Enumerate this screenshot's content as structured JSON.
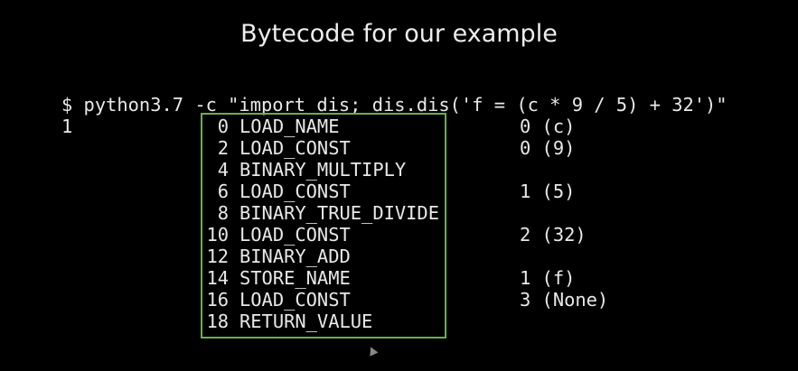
{
  "slide": {
    "title": "Bytecode for our example",
    "command": "$ python3.7 -c \"import dis; dis.dis('f = (c * 9 / 5) + 32')\"",
    "line_number": "1",
    "highlight_color": "#6cae48",
    "instructions": [
      {
        "offset": "0",
        "opname": "LOAD_NAME",
        "arg": "0 (c)"
      },
      {
        "offset": "2",
        "opname": "LOAD_CONST",
        "arg": "0 (9)"
      },
      {
        "offset": "4",
        "opname": "BINARY_MULTIPLY",
        "arg": ""
      },
      {
        "offset": "6",
        "opname": "LOAD_CONST",
        "arg": "1 (5)"
      },
      {
        "offset": "8",
        "opname": "BINARY_TRUE_DIVIDE",
        "arg": ""
      },
      {
        "offset": "10",
        "opname": "LOAD_CONST",
        "arg": "2 (32)"
      },
      {
        "offset": "12",
        "opname": "BINARY_ADD",
        "arg": ""
      },
      {
        "offset": "14",
        "opname": "STORE_NAME",
        "arg": "1 (f)"
      },
      {
        "offset": "16",
        "opname": "LOAD_CONST",
        "arg": "3 (None)"
      },
      {
        "offset": "18",
        "opname": "RETURN_VALUE",
        "arg": ""
      }
    ],
    "cursor_icon": "mouse-pointer-icon"
  }
}
